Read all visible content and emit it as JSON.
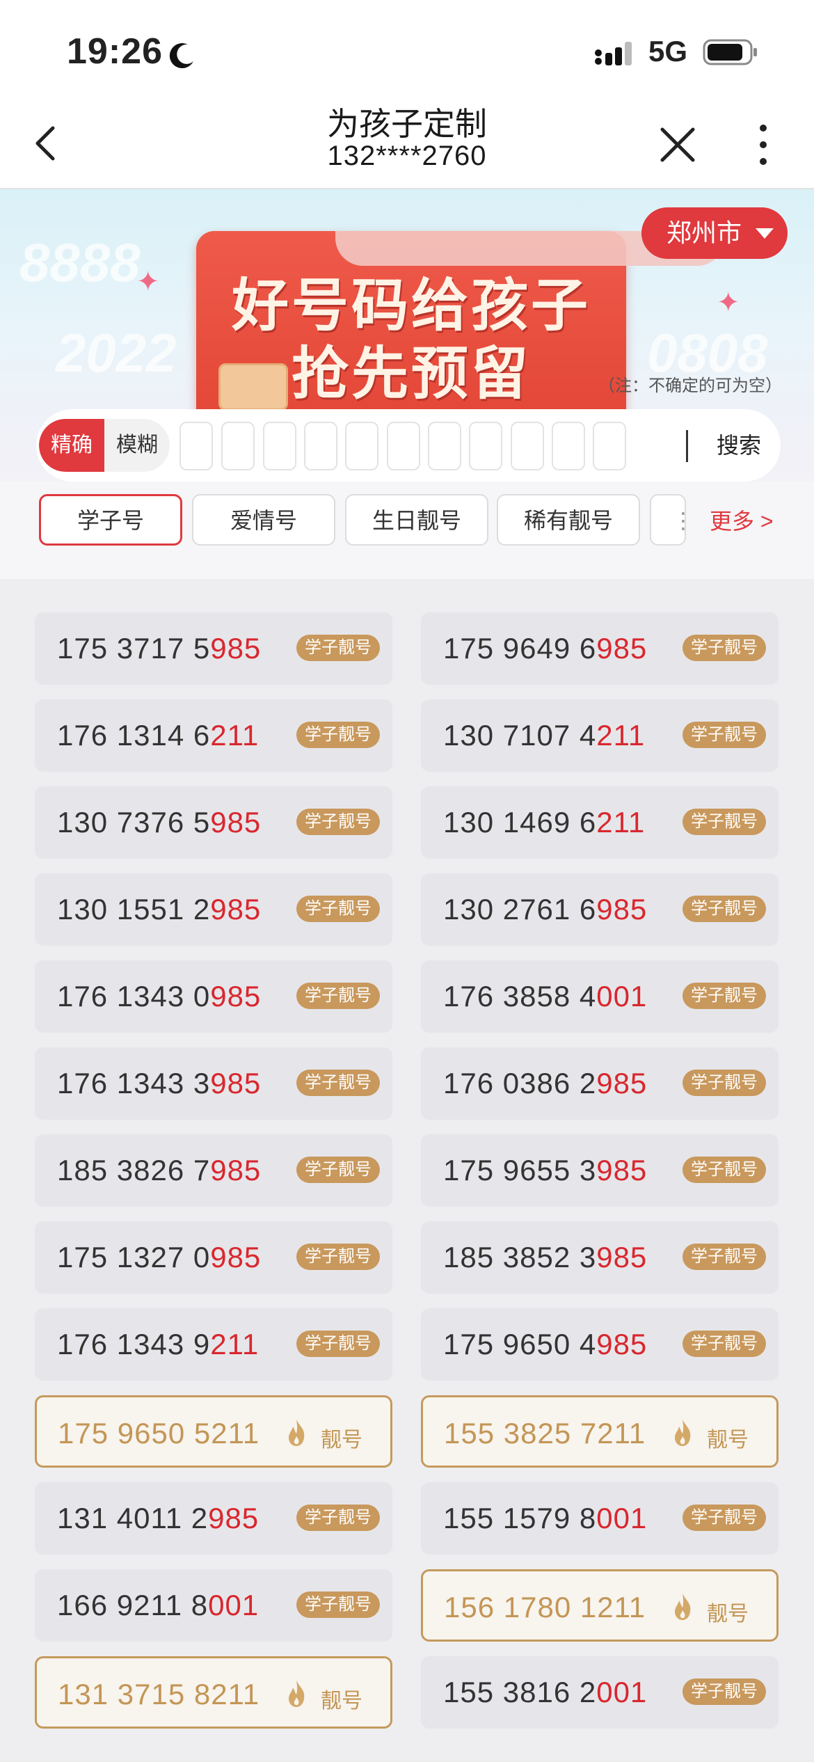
{
  "status_bar": {
    "time": "19:26",
    "network": "5G"
  },
  "nav": {
    "title": "为孩子定制",
    "subtitle": "132****2760"
  },
  "banner": {
    "slogan_line1": "好号码给孩子",
    "slogan_line2": "抢先预留",
    "city": "郑州市",
    "note": "（注：不确定的可为空）",
    "bg_numbers": [
      "8888",
      "2022",
      "0808"
    ]
  },
  "search": {
    "mode_exact": "精确",
    "mode_fuzzy": "模糊",
    "button": "搜索",
    "digit_slots": 11
  },
  "categories": {
    "tabs": [
      "学子号",
      "爱情号",
      "生日靓号",
      "稀有靓号"
    ],
    "active_index": 0,
    "more": "更多 >"
  },
  "numbers": [
    {
      "prefix": "175 3717 5",
      "highlight": "985",
      "badge": "学子靓号",
      "special": false
    },
    {
      "prefix": "175 9649 6",
      "highlight": "985",
      "badge": "学子靓号",
      "special": false
    },
    {
      "prefix": "176 1314 6",
      "highlight": "211",
      "badge": "学子靓号",
      "special": false
    },
    {
      "prefix": "130 7107 4",
      "highlight": "211",
      "badge": "学子靓号",
      "special": false
    },
    {
      "prefix": "130 7376 5",
      "highlight": "985",
      "badge": "学子靓号",
      "special": false
    },
    {
      "prefix": "130 1469 6",
      "highlight": "211",
      "badge": "学子靓号",
      "special": false
    },
    {
      "prefix": "130 1551 2",
      "highlight": "985",
      "badge": "学子靓号",
      "special": false
    },
    {
      "prefix": "130 2761 6",
      "highlight": "985",
      "badge": "学子靓号",
      "special": false
    },
    {
      "prefix": "176 1343 0",
      "highlight": "985",
      "badge": "学子靓号",
      "special": false
    },
    {
      "prefix": "176 3858 4",
      "highlight": "001",
      "badge": "学子靓号",
      "special": false
    },
    {
      "prefix": "176 1343 3",
      "highlight": "985",
      "badge": "学子靓号",
      "special": false
    },
    {
      "prefix": "176 0386 2",
      "highlight": "985",
      "badge": "学子靓号",
      "special": false
    },
    {
      "prefix": "185 3826 7",
      "highlight": "985",
      "badge": "学子靓号",
      "special": false
    },
    {
      "prefix": "175 9655 3",
      "highlight": "985",
      "badge": "学子靓号",
      "special": false
    },
    {
      "prefix": "175 1327 0",
      "highlight": "985",
      "badge": "学子靓号",
      "special": false
    },
    {
      "prefix": "185 3852 3",
      "highlight": "985",
      "badge": "学子靓号",
      "special": false
    },
    {
      "prefix": "176 1343 9",
      "highlight": "211",
      "badge": "学子靓号",
      "special": false
    },
    {
      "prefix": "175 9650 4",
      "highlight": "985",
      "badge": "学子靓号",
      "special": false
    },
    {
      "prefix": "175 9650 5211",
      "highlight": "",
      "badge": "靓号",
      "special": true
    },
    {
      "prefix": "155 3825 7211",
      "highlight": "",
      "badge": "靓号",
      "special": true
    },
    {
      "prefix": "131 4011 2",
      "highlight": "985",
      "badge": "学子靓号",
      "special": false
    },
    {
      "prefix": "155 1579 8",
      "highlight": "001",
      "badge": "学子靓号",
      "special": false
    },
    {
      "prefix": "166 9211 8",
      "highlight": "001",
      "badge": "学子靓号",
      "special": false
    },
    {
      "prefix": "156 1780 1211",
      "highlight": "",
      "badge": "靓号",
      "special": true
    },
    {
      "prefix": "131 3715 8211",
      "highlight": "",
      "badge": "靓号",
      "special": true
    },
    {
      "prefix": "155 3816 2",
      "highlight": "001",
      "badge": "学子靓号",
      "special": false
    }
  ],
  "colors": {
    "accent_red": "#e0393e",
    "gold": "#c8985c"
  }
}
